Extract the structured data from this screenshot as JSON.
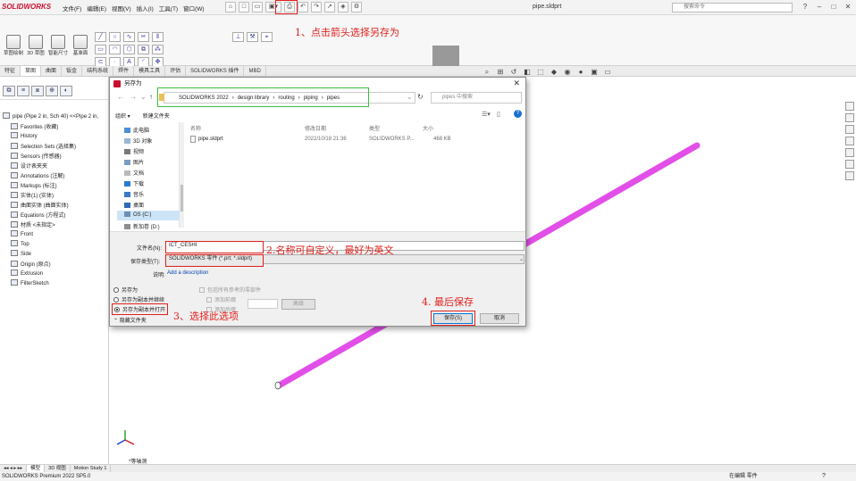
{
  "app": {
    "logo": "SOLIDWORKS",
    "menu": [
      "文件(F)",
      "编辑(E)",
      "视图(V)",
      "插入(I)",
      "工具(T)",
      "窗口(W)"
    ],
    "window_title": "pipe.sldprt",
    "command_search_placeholder": "搜索命令"
  },
  "command_manager": {
    "buttons": [
      "草图绘制",
      "3D 草图",
      "智能尺寸",
      "基准面"
    ],
    "instant2d": "Instant2D",
    "tabs": [
      "特征",
      "草图",
      "曲面",
      "钣金",
      "结构系统",
      "焊件",
      "模具工具",
      "评估",
      "SOLIDWORKS 插件",
      "MBD"
    ],
    "active_tab": "草图"
  },
  "annotations": {
    "step1": "1、点击箭头选择另存为",
    "step2": "2.名称可自定义，最好为英文",
    "step3": "3、选择此选项",
    "step4": "4. 最后保存"
  },
  "feature_tree": {
    "root": "pipe (Pipe 2 in, Sch 40) <<Pipe 2 in,",
    "items": [
      "Favorites (收藏)",
      "History",
      "Selection Sets (选择集)",
      "Sensors (传感器)",
      "设计表夹夹",
      "Annotations (注解)",
      "Markups (标注)",
      "实体(1) (实体)",
      "曲面实体 (曲面实体)",
      "Equations (方程式)",
      "材质 <未指定>",
      "Front",
      "Top",
      "Side",
      "Origin (原点)",
      "Extrusion",
      "FilterSketch"
    ]
  },
  "dialog": {
    "title": "另存为",
    "path": [
      "SOLIDWORKS 2022",
      "design library",
      "routing",
      "piping",
      "pipes"
    ],
    "search_placeholder": "pipes 中搜索",
    "organize": "组织 ▾",
    "new_folder": "新建文件夹",
    "nav_items": [
      "此电脑",
      "3D 对象",
      "视频",
      "图片",
      "文档",
      "下载",
      "音乐",
      "桌面",
      "OS (C:)",
      "新加卷 (D:)"
    ],
    "selected_nav": "OS (C:)",
    "columns": {
      "name": "名称",
      "modified": "修改日期",
      "type": "类型",
      "size": "大小"
    },
    "files": [
      {
        "name": "pipe.sldprt",
        "modified": "2022/10/18 21:36",
        "type": "SOLIDWORKS P...",
        "size": "468 KB"
      }
    ],
    "filename_label": "文件名(N):",
    "filename_value": "ICT_CESHI",
    "filetype_label": "保存类型(T):",
    "filetype_value": "SOLIDWORKS 零件 (*.prt; *.sldprt)",
    "description_label": "说明:",
    "description_link": "Add a description",
    "radio_options": [
      "另存为",
      "另存为副本并继续",
      "另存为副本并打开"
    ],
    "selected_radio_index": 2,
    "checkboxes": [
      "包括所有参考的零部件",
      "添加前缀",
      "添加后缀"
    ],
    "advanced_button": "高级",
    "hide_folders": "隐藏文件夹",
    "save_button": "保存(S)",
    "cancel_button": "取消"
  },
  "view": {
    "orientation_label": "*等轴测",
    "pipe_color": "#e24ee8"
  },
  "bottom_tabs": [
    "模型",
    "3D 视图",
    "Motion Study 1"
  ],
  "status_bar": {
    "left": "SOLIDWORKS Premium 2022 SP5.0",
    "right": "在编辑 零件"
  }
}
